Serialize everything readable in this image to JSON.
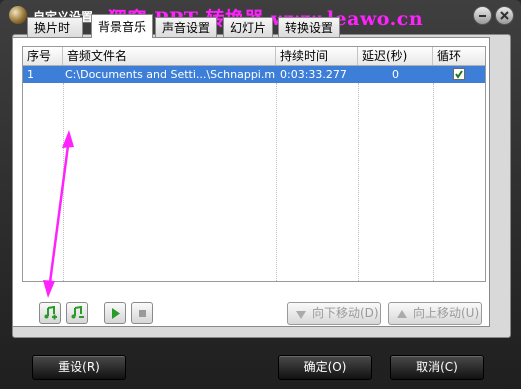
{
  "window": {
    "title": "自定义设置:",
    "banner": "狸窝 PPT 转换器 www.leawo.cn"
  },
  "tabs": [
    {
      "label": "换片时间"
    },
    {
      "label": "背景音乐"
    },
    {
      "label": "声音设置"
    },
    {
      "label": "幻灯片"
    },
    {
      "label": "转换设置"
    }
  ],
  "table": {
    "headers": [
      "序号",
      "音频文件名",
      "持续时间",
      "延迟(秒)",
      "循环"
    ],
    "rows": [
      {
        "index": "1",
        "file": "C:\\Documents and Setti...\\Schnappi.mp3",
        "duration": "0:03:33.277",
        "delay": "0",
        "loop": true
      }
    ]
  },
  "toolbar": {
    "move_down": "向下移动(D)",
    "move_up": "向上移动(U)"
  },
  "footer": {
    "reset": "重设(R)",
    "ok": "确定(O)",
    "cancel": "取消(C)"
  },
  "colors": {
    "banner": "#ff22ff",
    "selection": "#3d7fd8",
    "annotation_arrow": "#ff22ff",
    "add_icon": "#2a9a2a"
  },
  "icons": [
    "app-icon",
    "minimize-icon",
    "close-icon",
    "add-music-icon",
    "edit-music-icon",
    "play-icon",
    "stop-icon",
    "move-down-icon",
    "move-up-icon"
  ]
}
